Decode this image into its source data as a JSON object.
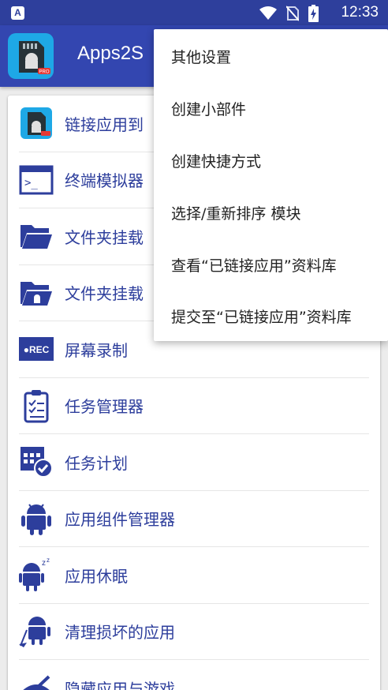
{
  "status_bar": {
    "time": "12:33",
    "app_badge": "A",
    "icons": [
      "wifi-icon",
      "no-sim-icon",
      "battery-charging-icon"
    ]
  },
  "app_bar": {
    "title": "Apps2S"
  },
  "menu_items": [
    {
      "label": "链接应用到",
      "icon": "sd-card-android-icon"
    },
    {
      "label": "终端模拟器",
      "icon": "terminal-icon"
    },
    {
      "label": "文件夹挂载",
      "icon": "folder-open-icon"
    },
    {
      "label": "文件夹挂载",
      "icon": "folder-android-icon"
    },
    {
      "label": "屏幕录制",
      "icon": "record-icon",
      "icon_text": "●REC"
    },
    {
      "label": "任务管理器",
      "icon": "clipboard-checklist-icon"
    },
    {
      "label": "任务计划",
      "icon": "calendar-check-icon"
    },
    {
      "label": "应用组件管理器",
      "icon": "android-icon"
    },
    {
      "label": "应用休眠",
      "icon": "android-sleep-icon"
    },
    {
      "label": "清理损坏的应用",
      "icon": "android-broom-icon"
    },
    {
      "label": "隐藏应用与游戏",
      "icon": "hide-icon"
    }
  ],
  "overflow_menu": {
    "items": [
      {
        "label": "其他设置"
      },
      {
        "label": "创建小部件"
      },
      {
        "label": "创建快捷方式"
      },
      {
        "label": "选择/重新排序 模块"
      },
      {
        "label": "查看“已链接应用”资料库"
      },
      {
        "label": "提交至“已链接应用”资料库"
      }
    ]
  },
  "colors": {
    "status_bar": "#2e3f9c",
    "app_bar": "#3346b0",
    "accent": "#2d3e9c",
    "background": "#ececec"
  }
}
